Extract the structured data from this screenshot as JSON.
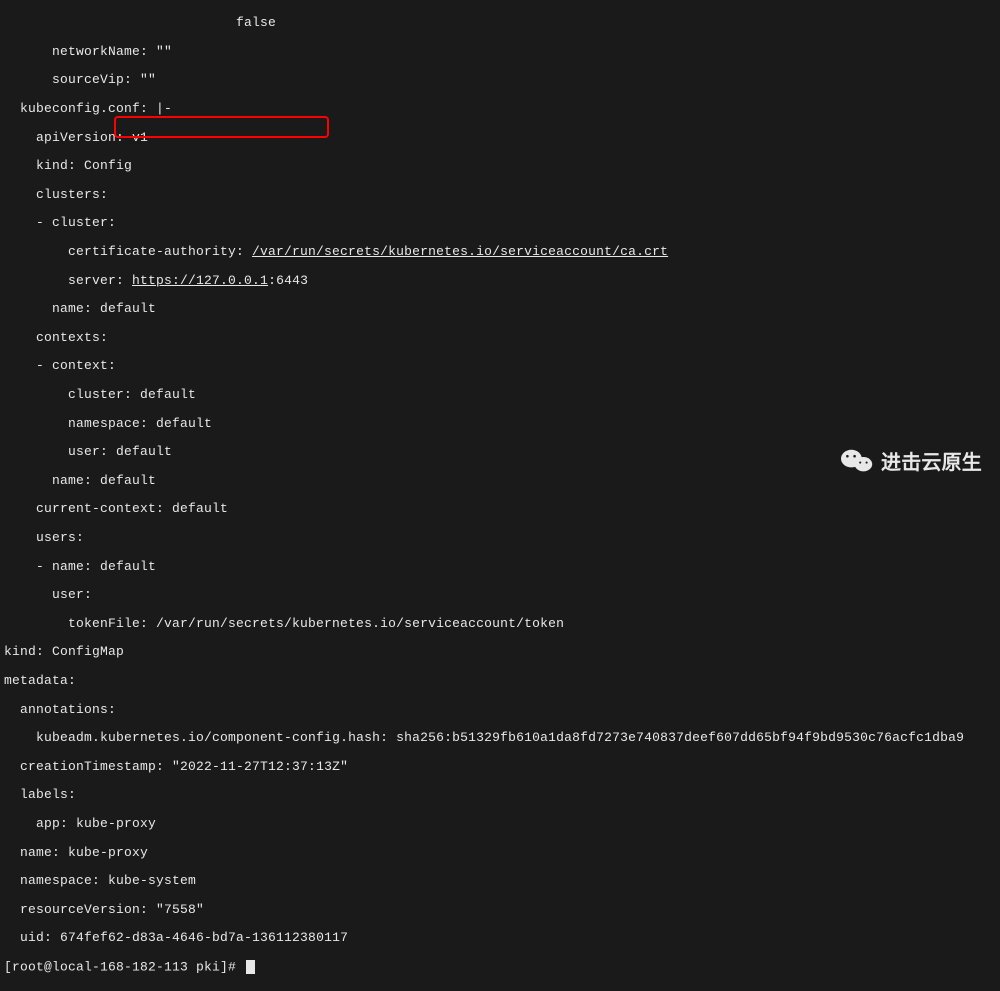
{
  "top_fragment": {
    "partial_value": "false",
    "networkName": "networkName: \"\"",
    "sourceVip": "sourceVip: \"\""
  },
  "kubeconfig_header": "kubeconfig.conf: |-",
  "kubeconfig": {
    "apiVersion": "apiVersion: v1",
    "kind": "kind: Config",
    "clusters_key": "clusters:",
    "cluster_dash": "- cluster:",
    "cert_auth_label": "certificate-authority: ",
    "cert_auth_path": "/var/run/secrets/kubernetes.io/serviceaccount/ca.crt",
    "server_label": "server: ",
    "server_url": "https://127.0.0.1",
    "server_port": ":6443",
    "cluster_name": "name: default",
    "contexts_key": "contexts:",
    "context_dash": "- context:",
    "ctx_cluster": "cluster: default",
    "ctx_namespace": "namespace: default",
    "ctx_user": "user: default",
    "ctx_name": "name: default",
    "current_context": "current-context: default",
    "users_key": "users:",
    "user_dash": "- name: default",
    "user_key": "user:",
    "tokenFile": "tokenFile: /var/run/secrets/kubernetes.io/serviceaccount/token"
  },
  "configmap": {
    "kind": "kind: ConfigMap",
    "metadata": "metadata:",
    "annotations": "annotations:",
    "hash": "kubeadm.kubernetes.io/component-config.hash: sha256:b51329fb610a1da8fd7273e740837deef607dd65bf94f9bd9530c76acfc1dba9",
    "creationTimestamp": "creationTimestamp: \"2022-11-27T12:37:13Z\"",
    "labels": "labels:",
    "app": "app: kube-proxy",
    "name": "name: kube-proxy",
    "namespace": "namespace: kube-system",
    "resourceVersion": "resourceVersion: \"7558\"",
    "uid": "uid: 674fef62-d83a-4646-bd7a-136112380117"
  },
  "prompt": "[root@local-168-182-113 pki]# ",
  "watermark": "进击云原生"
}
